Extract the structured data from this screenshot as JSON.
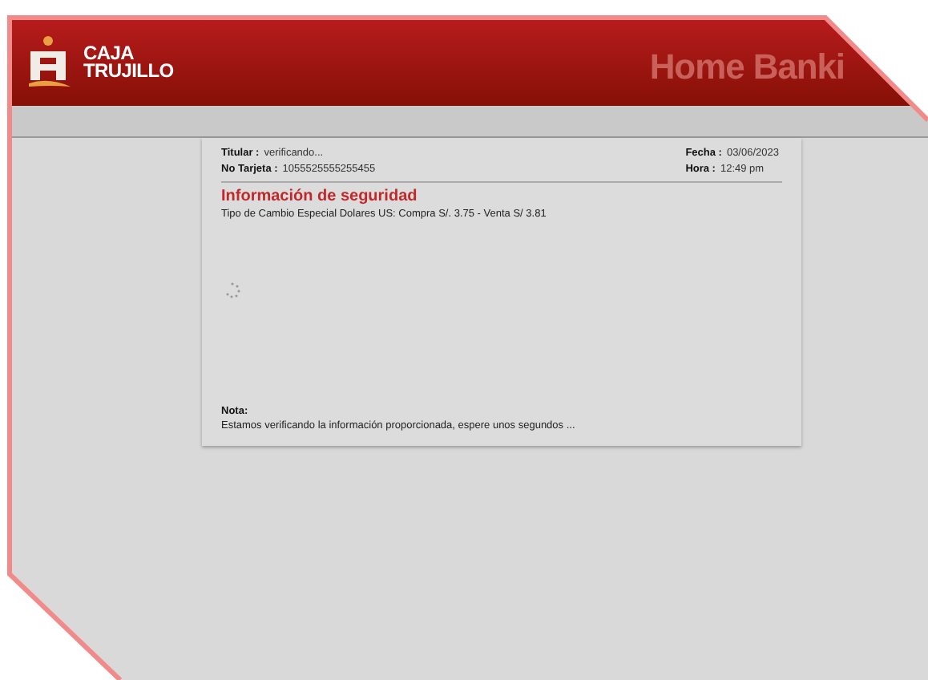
{
  "header": {
    "logo_lines": [
      "CAJA",
      "TRUJILLO"
    ],
    "title": "Home Banki"
  },
  "details_left": [
    {
      "label": "Titular :",
      "value": "verificando..."
    },
    {
      "label": "No Tarjeta :",
      "value": "1055525555255455"
    }
  ],
  "details_right": [
    {
      "label": "Fecha :",
      "value": "03/06/2023"
    },
    {
      "label": "Hora :",
      "value": "12:49 pm"
    }
  ],
  "section": {
    "title": "Información de seguridad",
    "exchange_rate": "Tipo de Cambio Especial Dolares US: Compra S/. 3.75 - Venta S/ 3.81"
  },
  "note": {
    "label": "Nota:",
    "text": "Estamos verificando la información proporcionada, espere unos segundos ..."
  }
}
